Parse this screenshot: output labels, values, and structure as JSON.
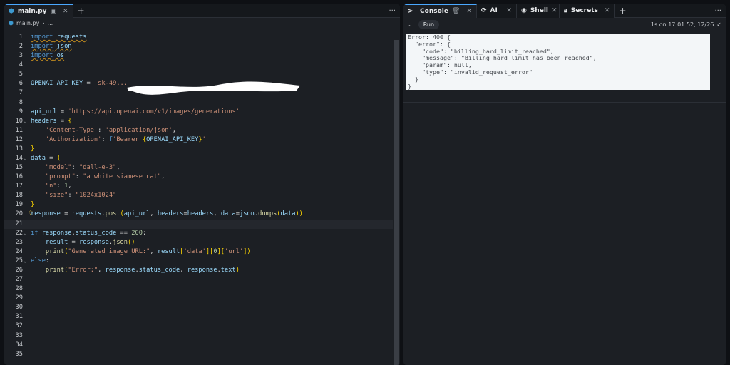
{
  "editor": {
    "tab_label": "main.py",
    "breadcrumb": [
      "main.py",
      "..."
    ],
    "lines": [
      [
        [
          "kw",
          "import"
        ],
        [
          "id",
          " requests"
        ]
      ],
      [
        [
          "kw",
          "import"
        ],
        [
          "id",
          " json"
        ]
      ],
      [
        [
          "kw",
          "import"
        ],
        [
          "id",
          " os"
        ]
      ],
      [],
      [],
      [
        [
          "id",
          "OPENAI_API_KEY"
        ],
        [
          "pl",
          " = "
        ],
        [
          "str",
          "'sk-49..."
        ]
      ],
      [],
      [],
      [
        [
          "id",
          "api_url"
        ],
        [
          "pl",
          " = "
        ],
        [
          "str",
          "'https://api.openai.com/v1/images/generations'"
        ]
      ],
      [
        [
          "id",
          "headers"
        ],
        [
          "pl",
          " = "
        ],
        [
          "br",
          "{"
        ]
      ],
      [
        [
          "pl",
          "    "
        ],
        [
          "str",
          "'Content-Type'"
        ],
        [
          "pl",
          ": "
        ],
        [
          "str",
          "'application/json'"
        ],
        [
          "pl",
          ","
        ]
      ],
      [
        [
          "pl",
          "    "
        ],
        [
          "str",
          "'Authorization'"
        ],
        [
          "pl",
          ": "
        ],
        [
          "kw",
          "f"
        ],
        [
          "str",
          "'Bearer "
        ],
        [
          "br",
          "{"
        ],
        [
          "id",
          "OPENAI_API_KEY"
        ],
        [
          "br",
          "}"
        ],
        [
          "str",
          "'"
        ]
      ],
      [
        [
          "br",
          "}"
        ]
      ],
      [
        [
          "id",
          "data"
        ],
        [
          "pl",
          " = "
        ],
        [
          "br",
          "{"
        ]
      ],
      [
        [
          "pl",
          "    "
        ],
        [
          "str",
          "\"model\""
        ],
        [
          "pl",
          ": "
        ],
        [
          "str",
          "\"dall-e-3\""
        ],
        [
          "pl",
          ","
        ]
      ],
      [
        [
          "pl",
          "    "
        ],
        [
          "str",
          "\"prompt\""
        ],
        [
          "pl",
          ": "
        ],
        [
          "str",
          "\"a white siamese cat\""
        ],
        [
          "pl",
          ","
        ]
      ],
      [
        [
          "pl",
          "    "
        ],
        [
          "str",
          "\"n\""
        ],
        [
          "pl",
          ": "
        ],
        [
          "num",
          "1"
        ],
        [
          "pl",
          ","
        ]
      ],
      [
        [
          "pl",
          "    "
        ],
        [
          "str",
          "\"size\""
        ],
        [
          "pl",
          ": "
        ],
        [
          "str",
          "\"1024x1024\""
        ]
      ],
      [
        [
          "br",
          "}"
        ]
      ],
      [
        [
          "id",
          "response"
        ],
        [
          "pl",
          " = "
        ],
        [
          "id",
          "requests"
        ],
        [
          "pl",
          "."
        ],
        [
          "fn",
          "post"
        ],
        [
          "br",
          "("
        ],
        [
          "id",
          "api_url"
        ],
        [
          "pl",
          ", "
        ],
        [
          "id",
          "headers"
        ],
        [
          "pl",
          "="
        ],
        [
          "id",
          "headers"
        ],
        [
          "pl",
          ", "
        ],
        [
          "id",
          "data"
        ],
        [
          "pl",
          "="
        ],
        [
          "id",
          "json"
        ],
        [
          "pl",
          "."
        ],
        [
          "fn",
          "dumps"
        ],
        [
          "br",
          "("
        ],
        [
          "id",
          "data"
        ],
        [
          "br",
          "))"
        ]
      ],
      [],
      [
        [
          "kw",
          "if"
        ],
        [
          "id",
          " response"
        ],
        [
          "pl",
          "."
        ],
        [
          "id",
          "status_code"
        ],
        [
          "pl",
          " == "
        ],
        [
          "num",
          "200"
        ],
        [
          "pl",
          ":"
        ]
      ],
      [
        [
          "pl",
          "    "
        ],
        [
          "id",
          "result"
        ],
        [
          "pl",
          " = "
        ],
        [
          "id",
          "response"
        ],
        [
          "pl",
          "."
        ],
        [
          "fn",
          "json"
        ],
        [
          "br",
          "()"
        ]
      ],
      [
        [
          "pl",
          "    "
        ],
        [
          "fn",
          "print"
        ],
        [
          "br",
          "("
        ],
        [
          "str",
          "\"Generated image URL:\""
        ],
        [
          "pl",
          ", "
        ],
        [
          "id",
          "result"
        ],
        [
          "br",
          "["
        ],
        [
          "str",
          "'data'"
        ],
        [
          "br",
          "]["
        ],
        [
          "num",
          "0"
        ],
        [
          "br",
          "]["
        ],
        [
          "str",
          "'url'"
        ],
        [
          "br",
          "])"
        ]
      ],
      [
        [
          "kw",
          "else"
        ],
        [
          "pl",
          ":"
        ]
      ],
      [
        [
          "pl",
          "    "
        ],
        [
          "fn",
          "print"
        ],
        [
          "br",
          "("
        ],
        [
          "str",
          "\"Error:\""
        ],
        [
          "pl",
          ", "
        ],
        [
          "id",
          "response"
        ],
        [
          "pl",
          "."
        ],
        [
          "id",
          "status_code"
        ],
        [
          "pl",
          ", "
        ],
        [
          "id",
          "response"
        ],
        [
          "pl",
          "."
        ],
        [
          "id",
          "text"
        ],
        [
          "br",
          ")"
        ]
      ],
      [],
      [],
      [],
      [],
      [],
      [],
      [],
      [],
      []
    ],
    "fold_lines": [
      10,
      14,
      22,
      25
    ],
    "current_line": 21
  },
  "right": {
    "tabs": [
      {
        "label": "Console",
        "icon": "console-icon"
      },
      {
        "label": "AI",
        "icon": "ai-icon"
      },
      {
        "label": "Shell",
        "icon": "shell-icon"
      },
      {
        "label": "Secrets",
        "icon": "lock-icon"
      }
    ],
    "run_label": "Run",
    "status": "1s on 17:01:52, 12/26",
    "output": "Error: 400 {\n  \"error\": {\n    \"code\": \"billing_hard_limit_reached\",\n    \"message\": \"Billing hard limit has been reached\",\n    \"param\": null,\n    \"type\": \"invalid_request_error\"\n  }\n}"
  }
}
